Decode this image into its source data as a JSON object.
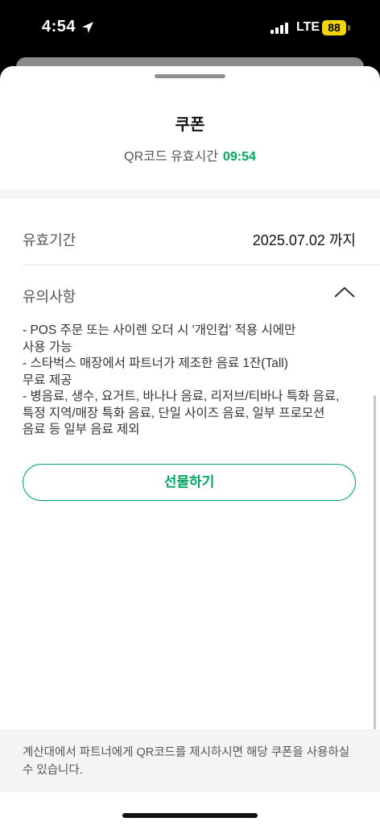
{
  "status_bar": {
    "time": "4:54",
    "network": "LTE",
    "battery": "88",
    "icons": {
      "location": "location-arrow-icon",
      "signal": "cellular-signal-icon"
    }
  },
  "coupon": {
    "title": "쿠폰",
    "qr_label": "QR코드 유효시간",
    "qr_time": "09:54",
    "validity_label": "유효기간",
    "validity_value": "2025.07.02 까지",
    "notes_label": "유의사항",
    "notes_text": "- POS 주문 또는 사이렌 오더 시 '개인컵' 적용 시에만\n사용 가능\n- 스타벅스 매장에서 파트너가 제조한 음료 1잔(Tall)\n무료 제공\n- 병음료, 생수, 요거트, 바나나 음료, 리저브/티바나 특화 음료,\n특정 지역/매장 특화 음료, 단일 사이즈 음료, 일부 프로모션\n음료 등 일부 음료 제외",
    "gift_button": "선물하기",
    "footer_text": "계산대에서 파트너에게 QR코드를 제시하시면 해당 쿠폰을 사용하실 수 있습니다."
  },
  "colors": {
    "accent": "#00a862",
    "battery": "#f2d413"
  }
}
